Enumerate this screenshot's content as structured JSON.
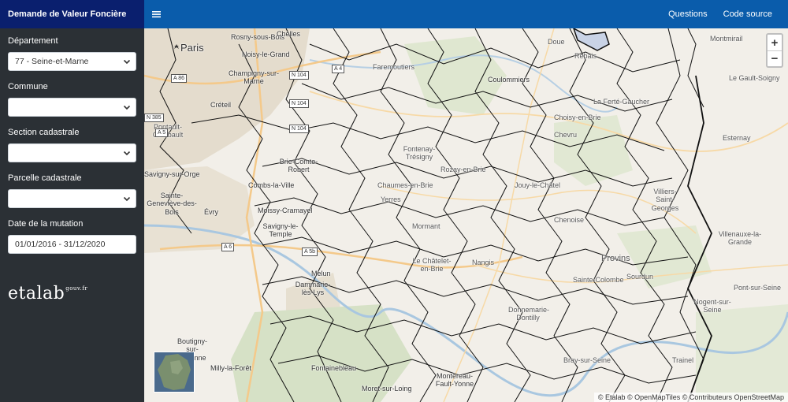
{
  "app": {
    "title": "Demande de Valeur Foncière"
  },
  "topbar": {
    "links": [
      "Questions",
      "Code source"
    ]
  },
  "form": {
    "departement": {
      "label": "Département",
      "value": "77 - Seine-et-Marne"
    },
    "commune": {
      "label": "Commune",
      "value": ""
    },
    "section": {
      "label": "Section cadastrale",
      "value": ""
    },
    "parcelle": {
      "label": "Parcelle cadastrale",
      "value": ""
    },
    "date": {
      "label": "Date de la mutation",
      "value": "01/01/2016 - 31/12/2020"
    }
  },
  "logo": {
    "text": "etalab",
    "sup": "gouv.fr"
  },
  "map": {
    "zoom_in": "+",
    "zoom_out": "−",
    "attribution": "© Etalab © OpenMapTiles © Contributeurs OpenStreetMap",
    "labels": [
      "Paris",
      "Rosny-sous-Bois",
      "Chelles",
      "Noisy-le-Grand",
      "Champigny-sur-Marne",
      "Créteil",
      "Savigny-sur-Orge",
      "Sainte-Geneviève-des-Bois",
      "Évry",
      "Combs-la-Ville",
      "Moissy-Cramayel",
      "Savigny-le-Temple",
      "Brie-Comte-Robert",
      "Melun",
      "Dammarie-lès-Lys",
      "Boutigny-sur-Essonne",
      "Milly-la-Forêt",
      "Fontainebleau",
      "Moret-sur-Loing",
      "Montereau-Fault-Yonne",
      "Coulommiers",
      "Rebais",
      "Doue",
      "Montmirail",
      "Le Gault-Soigny",
      "La Ferté-Gaucher",
      "Choisy-en-Brie",
      "Chevru",
      "Esternay",
      "Fontenay-Trésigny",
      "Rozay-en-Brie",
      "Chaumes-en-Brie",
      "Yerres",
      "Mormant",
      "Jouy-le-Châtel",
      "Chenoise",
      "Villiers-Saint-Georges",
      "Villenauxe-la-Grande",
      "Provins",
      "Sourdun",
      "Pont-sur-Seine",
      "Nogent-sur-Seine",
      "Le Châtelet-en-Brie",
      "Nangis",
      "Sainte-Colombe",
      "Donnemarie-Dontilly",
      "Bray-sur-Seine",
      "Trainel",
      "Faremoutiers",
      "Pontault-Combault"
    ],
    "roads": [
      "A 86",
      "N 104",
      "A 4",
      "N 104",
      "N 104",
      "A 6",
      "A 5b",
      "N 385",
      "A 5"
    ]
  }
}
